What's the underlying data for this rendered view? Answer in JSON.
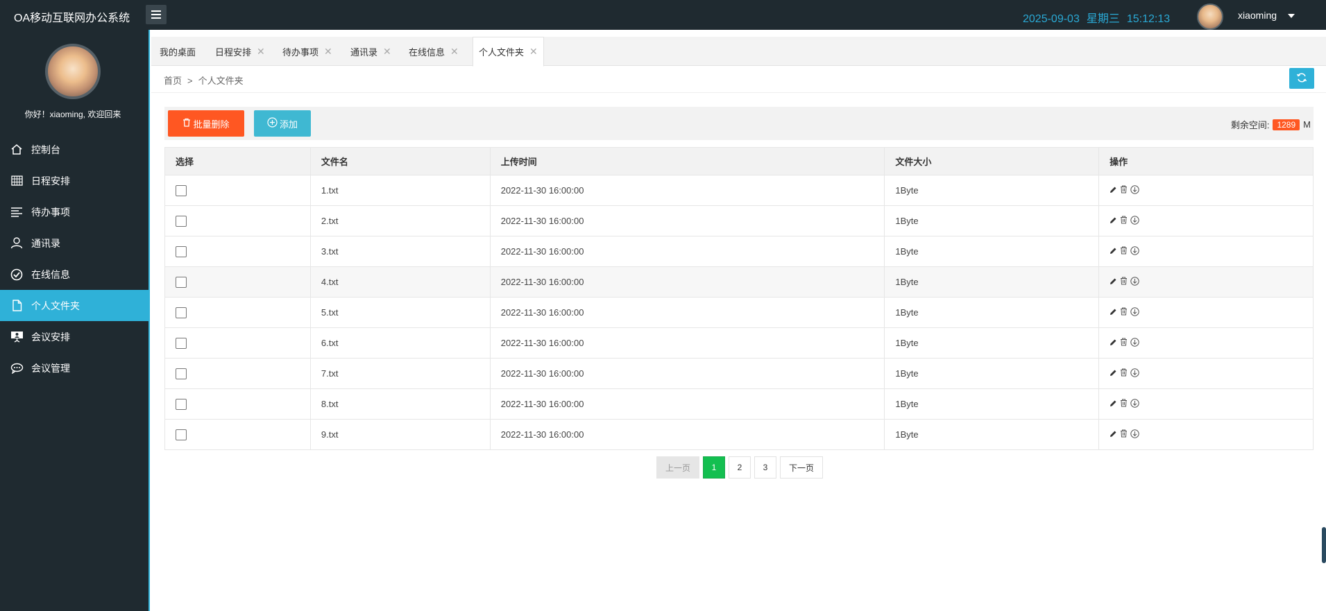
{
  "header": {
    "title": "OA移动互联网办公系统",
    "date": "2025-09-03",
    "weekday": "星期三",
    "time": "15:12:13",
    "username": "xiaoming"
  },
  "sidebar": {
    "welcome": "你好！xiaoming, 欢迎回来",
    "items": [
      {
        "label": "控制台",
        "icon": "home-icon"
      },
      {
        "label": "日程安排",
        "icon": "calendar-grid-icon"
      },
      {
        "label": "待办事项",
        "icon": "list-icon"
      },
      {
        "label": "通讯录",
        "icon": "user-icon"
      },
      {
        "label": "在线信息",
        "icon": "check-circle-icon"
      },
      {
        "label": "个人文件夹",
        "icon": "file-icon"
      },
      {
        "label": "会议安排",
        "icon": "presentation-icon"
      },
      {
        "label": "会议管理",
        "icon": "chat-icon"
      }
    ],
    "active_index": 5
  },
  "tabs": [
    {
      "label": "我的桌面",
      "closable": false
    },
    {
      "label": "日程安排",
      "closable": true
    },
    {
      "label": "待办事项",
      "closable": true
    },
    {
      "label": "通讯录",
      "closable": true
    },
    {
      "label": "在线信息",
      "closable": true
    },
    {
      "label": "个人文件夹",
      "closable": true
    }
  ],
  "breadcrumb": {
    "home": "首页",
    "sep": ">",
    "current": "个人文件夹"
  },
  "toolbar": {
    "batch_delete": "批量删除",
    "add": "添加",
    "space_label": "剩余空间:",
    "space_value": "1289",
    "space_unit": "M"
  },
  "table": {
    "headers": [
      "选择",
      "文件名",
      "上传时间",
      "文件大小",
      "操作"
    ],
    "rows": [
      {
        "name": "1.txt",
        "time": "2022-11-30 16:00:00",
        "size": "1Byte"
      },
      {
        "name": "2.txt",
        "time": "2022-11-30 16:00:00",
        "size": "1Byte"
      },
      {
        "name": "3.txt",
        "time": "2022-11-30 16:00:00",
        "size": "1Byte"
      },
      {
        "name": "4.txt",
        "time": "2022-11-30 16:00:00",
        "size": "1Byte"
      },
      {
        "name": "5.txt",
        "time": "2022-11-30 16:00:00",
        "size": "1Byte"
      },
      {
        "name": "6.txt",
        "time": "2022-11-30 16:00:00",
        "size": "1Byte"
      },
      {
        "name": "7.txt",
        "time": "2022-11-30 16:00:00",
        "size": "1Byte"
      },
      {
        "name": "8.txt",
        "time": "2022-11-30 16:00:00",
        "size": "1Byte"
      },
      {
        "name": "9.txt",
        "time": "2022-11-30 16:00:00",
        "size": "1Byte"
      }
    ]
  },
  "pagination": {
    "prev": "上一页",
    "pages": [
      "1",
      "2",
      "3"
    ],
    "current": "1",
    "next": "下一页"
  },
  "colors": {
    "accent": "#2fb1d8",
    "danger": "#ff5722",
    "info": "#3fb8d2",
    "current_page": "#13bf50",
    "dark": "#1f2a30"
  }
}
